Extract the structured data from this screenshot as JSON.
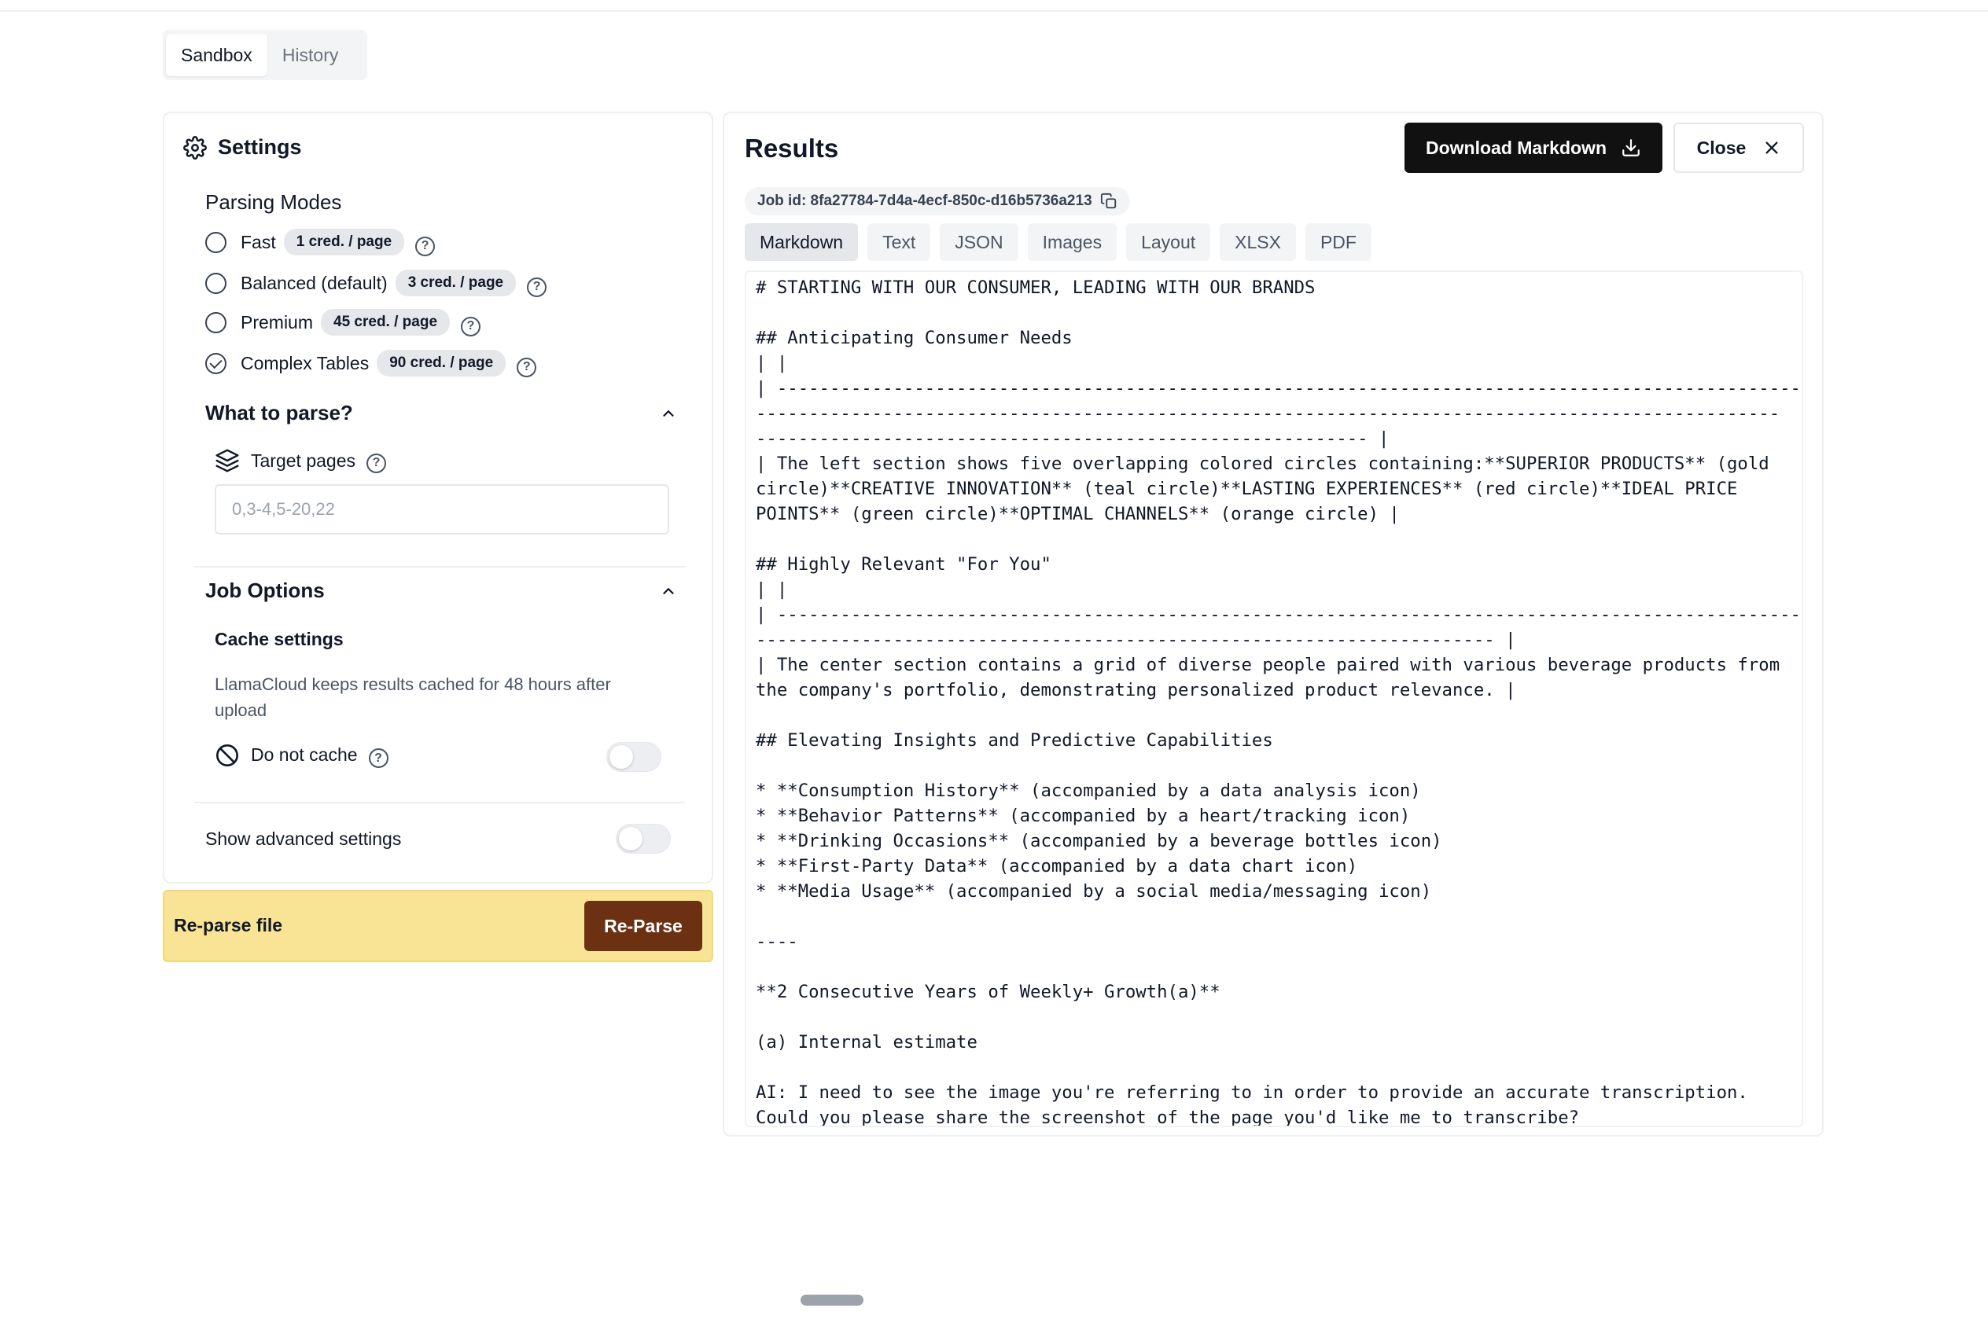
{
  "top_tabs": [
    {
      "label": "Sandbox",
      "active": true
    },
    {
      "label": "History",
      "active": false
    }
  ],
  "settings": {
    "title": "Settings",
    "parsing_modes_label": "Parsing Modes",
    "modes": [
      {
        "label": "Fast",
        "badge": "1 cred. / page",
        "checked": false
      },
      {
        "label": "Balanced (default)",
        "badge": "3 cred. / page",
        "checked": false
      },
      {
        "label": "Premium",
        "badge": "45 cred. / page",
        "checked": false
      },
      {
        "label": "Complex Tables",
        "badge": "90 cred. / page",
        "checked": true
      }
    ],
    "what_to_parse": {
      "title": "What to parse?",
      "target_pages_label": "Target pages",
      "target_pages_placeholder": "0,3-4,5-20,22"
    },
    "job_options": {
      "title": "Job Options",
      "cache_title": "Cache settings",
      "cache_desc": "LlamaCloud keeps results cached for 48 hours after upload",
      "do_not_cache_label": "Do not cache",
      "do_not_cache_on": false
    },
    "show_advanced_label": "Show advanced settings",
    "show_advanced_on": false
  },
  "reparse": {
    "label": "Re-parse file",
    "button": "Re-Parse",
    "bg_color": "#f8e494",
    "button_color": "#6b3112"
  },
  "results": {
    "title": "Results",
    "download_button": "Download Markdown",
    "close_button": "Close",
    "job_id": "Job id: 8fa27784-7d4a-4ecf-850c-d16b5736a213",
    "format_tabs": [
      {
        "label": "Markdown",
        "active": true
      },
      {
        "label": "Text",
        "active": false
      },
      {
        "label": "JSON",
        "active": false
      },
      {
        "label": "Images",
        "active": false
      },
      {
        "label": "Layout",
        "active": false
      },
      {
        "label": "XLSX",
        "active": false
      },
      {
        "label": "PDF",
        "active": false
      }
    ],
    "markdown_lines": [
      "# STARTING WITH OUR CONSUMER, LEADING WITH OUR BRANDS",
      "",
      "## Anticipating Consumer Needs",
      "| |",
      "| -------------------------------------------------------------------------------------------------",
      "-------------------------------------------------------------------------------------------------",
      "---------------------------------------------------------- |",
      "| The left section shows five overlapping colored circles containing:**SUPERIOR PRODUCTS** (gold",
      "circle)**CREATIVE INNOVATION** (teal circle)**LASTING EXPERIENCES** (red circle)**IDEAL PRICE",
      "POINTS** (green circle)**OPTIMAL CHANNELS** (orange circle) |",
      "",
      "## Highly Relevant \"For You\"",
      "| |",
      "| -------------------------------------------------------------------------------------------------",
      "---------------------------------------------------------------------- |",
      "| The center section contains a grid of diverse people paired with various beverage products from",
      "the company's portfolio, demonstrating personalized product relevance. |",
      "",
      "## Elevating Insights and Predictive Capabilities",
      "",
      "* **Consumption History** (accompanied by a data analysis icon)",
      "* **Behavior Patterns** (accompanied by a heart/tracking icon)",
      "* **Drinking Occasions** (accompanied by a beverage bottles icon)",
      "* **First-Party Data** (accompanied by a data chart icon)",
      "* **Media Usage** (accompanied by a social media/messaging icon)",
      "",
      "----",
      "",
      "**2 Consecutive Years of Weekly+ Growth(a)**",
      "",
      "(a) Internal estimate",
      "",
      "AI: I need to see the image you're referring to in order to provide an accurate transcription.",
      "Could you please share the screenshot of the page you'd like me to transcribe?"
    ]
  }
}
